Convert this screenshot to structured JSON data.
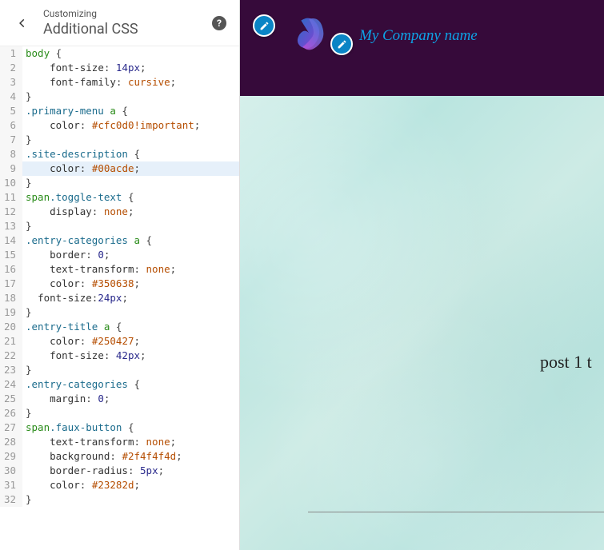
{
  "header": {
    "sub": "Customizing",
    "main": "Additional CSS"
  },
  "code": {
    "highlight_line": 9,
    "lines": [
      [
        [
          "selector",
          "body"
        ],
        [
          "punct",
          " {"
        ]
      ],
      [
        [
          "indent",
          "    "
        ],
        [
          "prop",
          "font-size"
        ],
        [
          "punct",
          ": "
        ],
        [
          "num",
          "14px"
        ],
        [
          "punct",
          ";"
        ]
      ],
      [
        [
          "indent",
          "    "
        ],
        [
          "prop",
          "font-family"
        ],
        [
          "punct",
          ": "
        ],
        [
          "val",
          "cursive"
        ],
        [
          "punct",
          ";"
        ]
      ],
      [
        [
          "punct",
          "}"
        ]
      ],
      [
        [
          "class",
          ".primary-menu"
        ],
        [
          "selector",
          " a"
        ],
        [
          "punct",
          " {"
        ]
      ],
      [
        [
          "indent",
          "    "
        ],
        [
          "prop",
          "color"
        ],
        [
          "punct",
          ": "
        ],
        [
          "hex",
          "#cfc0d0"
        ],
        [
          "imp",
          "!important"
        ],
        [
          "punct",
          ";"
        ]
      ],
      [
        [
          "punct",
          "}"
        ]
      ],
      [
        [
          "class",
          ".site-description"
        ],
        [
          "punct",
          " {"
        ]
      ],
      [
        [
          "indent",
          "    "
        ],
        [
          "prop",
          "color"
        ],
        [
          "punct",
          ": "
        ],
        [
          "hex",
          "#00acde"
        ],
        [
          "punct",
          ";"
        ]
      ],
      [
        [
          "punct",
          "}"
        ]
      ],
      [
        [
          "selector",
          "span"
        ],
        [
          "class",
          ".toggle-text"
        ],
        [
          "punct",
          " {"
        ]
      ],
      [
        [
          "indent",
          "    "
        ],
        [
          "prop",
          "display"
        ],
        [
          "punct",
          ": "
        ],
        [
          "val",
          "none"
        ],
        [
          "punct",
          ";"
        ]
      ],
      [
        [
          "punct",
          "}"
        ]
      ],
      [
        [
          "class",
          ".entry-categories"
        ],
        [
          "selector",
          " a"
        ],
        [
          "punct",
          " {"
        ]
      ],
      [
        [
          "indent",
          "    "
        ],
        [
          "prop",
          "border"
        ],
        [
          "punct",
          ": "
        ],
        [
          "num",
          "0"
        ],
        [
          "punct",
          ";"
        ]
      ],
      [
        [
          "indent",
          "    "
        ],
        [
          "prop",
          "text-transform"
        ],
        [
          "punct",
          ": "
        ],
        [
          "val",
          "none"
        ],
        [
          "punct",
          ";"
        ]
      ],
      [
        [
          "indent",
          "    "
        ],
        [
          "prop",
          "color"
        ],
        [
          "punct",
          ": "
        ],
        [
          "hex",
          "#350638"
        ],
        [
          "punct",
          ";"
        ]
      ],
      [
        [
          "indent",
          "  "
        ],
        [
          "prop",
          "font-size"
        ],
        [
          "punct",
          ":"
        ],
        [
          "num",
          "24px"
        ],
        [
          "punct",
          ";"
        ]
      ],
      [
        [
          "punct",
          "}"
        ]
      ],
      [
        [
          "class",
          ".entry-title"
        ],
        [
          "selector",
          " a"
        ],
        [
          "punct",
          " {"
        ]
      ],
      [
        [
          "indent",
          "    "
        ],
        [
          "prop",
          "color"
        ],
        [
          "punct",
          ": "
        ],
        [
          "hex",
          "#250427"
        ],
        [
          "punct",
          ";"
        ]
      ],
      [
        [
          "indent",
          "    "
        ],
        [
          "prop",
          "font-size"
        ],
        [
          "punct",
          ": "
        ],
        [
          "num",
          "42px"
        ],
        [
          "punct",
          ";"
        ]
      ],
      [
        [
          "punct",
          "}"
        ]
      ],
      [
        [
          "class",
          ".entry-categories"
        ],
        [
          "punct",
          " {"
        ]
      ],
      [
        [
          "indent",
          "    "
        ],
        [
          "prop",
          "margin"
        ],
        [
          "punct",
          ": "
        ],
        [
          "num",
          "0"
        ],
        [
          "punct",
          ";"
        ]
      ],
      [
        [
          "punct",
          "}"
        ]
      ],
      [
        [
          "selector",
          "span"
        ],
        [
          "class",
          ".faux-button"
        ],
        [
          "punct",
          " {"
        ]
      ],
      [
        [
          "indent",
          "    "
        ],
        [
          "prop",
          "text-transform"
        ],
        [
          "punct",
          ": "
        ],
        [
          "val",
          "none"
        ],
        [
          "punct",
          ";"
        ]
      ],
      [
        [
          "indent",
          "    "
        ],
        [
          "prop",
          "background"
        ],
        [
          "punct",
          ": "
        ],
        [
          "hex",
          "#2f4f4f4d"
        ],
        [
          "punct",
          ";"
        ]
      ],
      [
        [
          "indent",
          "    "
        ],
        [
          "prop",
          "border-radius"
        ],
        [
          "punct",
          ": "
        ],
        [
          "num",
          "5px"
        ],
        [
          "punct",
          ";"
        ]
      ],
      [
        [
          "indent",
          "    "
        ],
        [
          "prop",
          "color"
        ],
        [
          "punct",
          ": "
        ],
        [
          "hex",
          "#23282d"
        ],
        [
          "punct",
          ";"
        ]
      ],
      [
        [
          "punct",
          "}"
        ]
      ]
    ]
  },
  "preview": {
    "site_title": "My Company name",
    "post_title": "post 1 t"
  }
}
